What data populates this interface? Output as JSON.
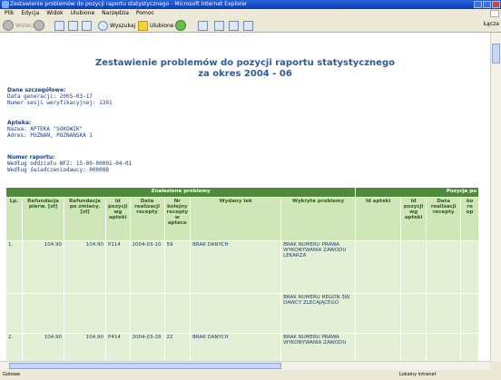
{
  "window": {
    "title": "Zestawienie problemów do pozycji raportu statystycznego - Microsoft Internet Explorer"
  },
  "menu": [
    "Plik",
    "Edycja",
    "Widok",
    "Ulubione",
    "Narzędzia",
    "Pomoc"
  ],
  "toolbar": {
    "back": "Wstecz",
    "search": "Wyszukaj",
    "favorites": "Ulubione",
    "links": "Łącza"
  },
  "page": {
    "title_line1": "Zestawienie problemów do pozycji raportu statystycznego",
    "title_line2": "za okres 2004 - 06"
  },
  "details": {
    "header": "Dane szczegółowe:",
    "gen_date": "Data generacji: 2005-03-17",
    "session": "Numer sesji weryfikacyjnej: 1391"
  },
  "pharmacy": {
    "header": "Apteka:",
    "name": "Nazwa: APTEKA \"SOKOWIK\"",
    "address": "Adres: POZNAŃ, POZNAŃSKA 1"
  },
  "report": {
    "header": "Numer raportu:",
    "nfz": "Według oddziału NFZ: 15-00-00001-04-01",
    "provider": "Według świadczeniodawcy: 000088"
  },
  "table": {
    "group_found": "Znalezione problemy",
    "group_positions": "Pozycje pu",
    "headers": [
      "Lp.",
      "Refundacja pierw. [zł]",
      "Refundacja po zmiany. [zł]",
      "Id pozycji wg apteki",
      "Data realizacji recepty",
      "Nr kolejny recepty w aptece",
      "Wydany lek",
      "Wykryte problemy",
      "Id apteki",
      "Id pozycji wg apteki",
      "Data realizacji recepty",
      "ko re",
      "op"
    ],
    "rows": [
      {
        "lp": "1.",
        "ref1": "104.90",
        "ref2": "104.90",
        "id": "P114",
        "date": "2004-03-10",
        "nr": "59",
        "lek": "BRAK DANYCH",
        "problems": [
          "BRAK NUMERU PRAWA WYKONYWANIA ZAWODU LEKARZA",
          "BRAK NUMERU REGON ŚW. DAWCY ZLECAJĄCEGO"
        ]
      },
      {
        "lp": "2.",
        "ref1": "104.90",
        "ref2": "104.90",
        "id": "P414",
        "date": "2004-03-28",
        "nr": "22",
        "lek": "BRAK DANYCH",
        "problems": [
          "BRAK NUMERU PRAWA WYKONYWANIA ZAWODU"
        ]
      }
    ]
  },
  "status": {
    "left": "Gotowe",
    "right": "Lokalny intranet"
  }
}
